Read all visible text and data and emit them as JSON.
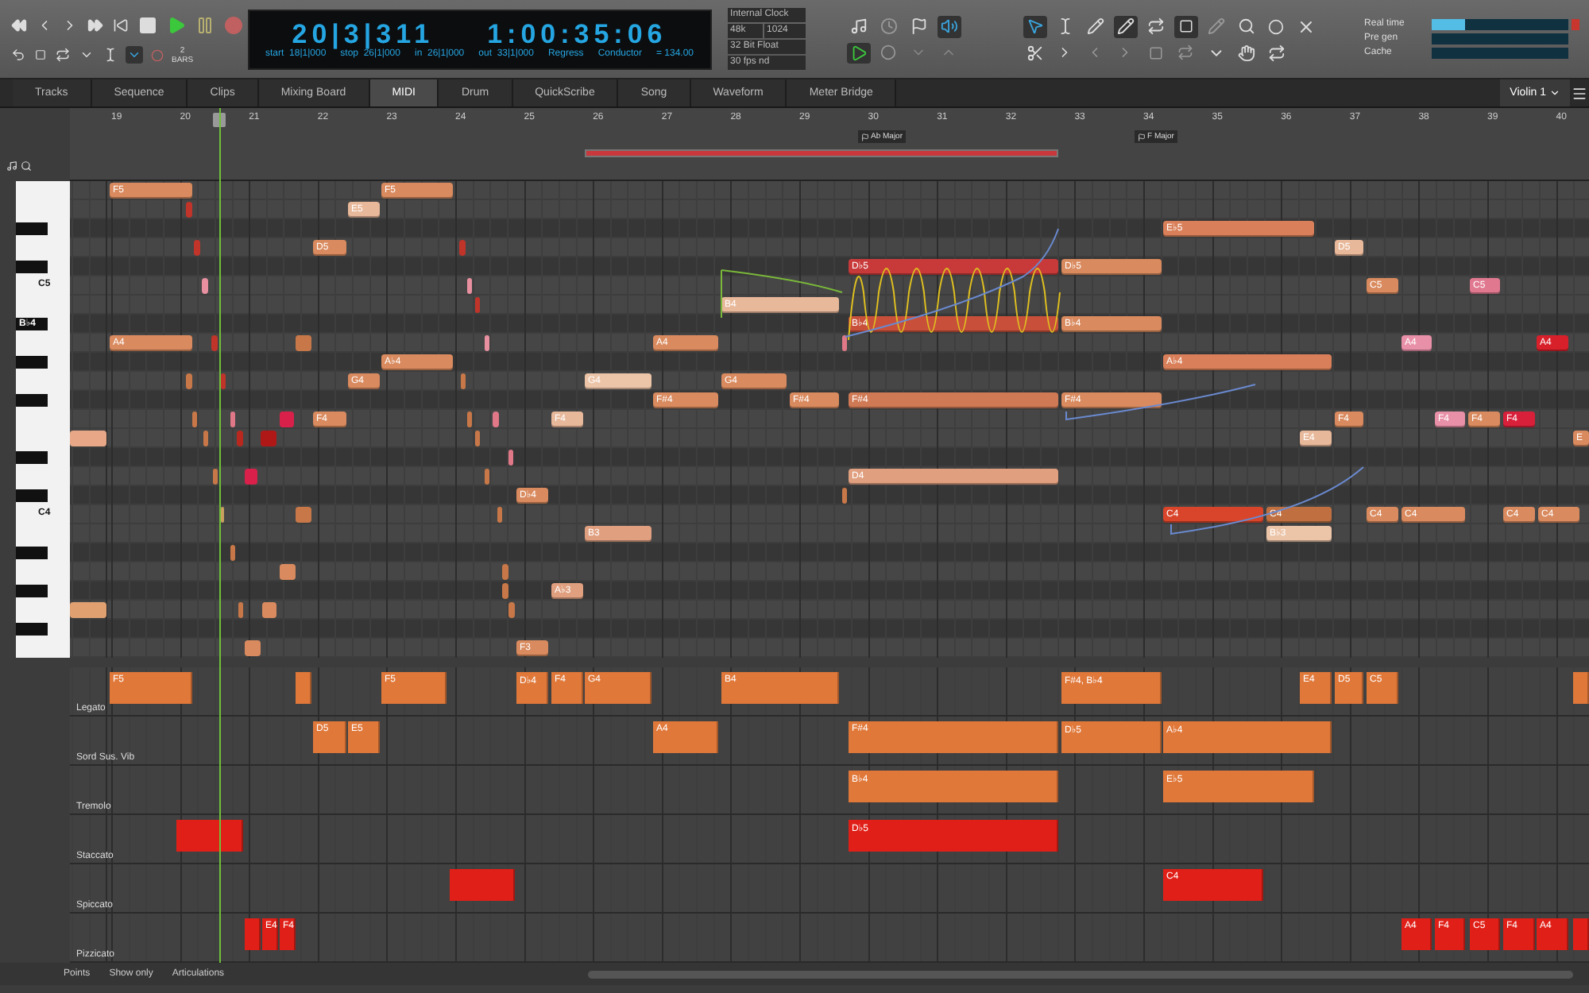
{
  "transport": {
    "position": "20|3|311",
    "time": "1:00:35:06",
    "bars_count": "2",
    "bars_unit": "BARS",
    "fields": [
      {
        "label": "start",
        "value": "18|1|000"
      },
      {
        "label": "stop",
        "value": "26|1|000"
      },
      {
        "label": "in",
        "value": "26|1|000"
      },
      {
        "label": "out",
        "value": "33|1|000"
      }
    ],
    "mode": "Regress",
    "conductor": "Conductor",
    "tempo": "= 134.00"
  },
  "audio": {
    "clock": "Internal Clock",
    "rate": "48k",
    "buffer": "1024",
    "format": "32 Bit Float",
    "frame_rate": "30 fps nd"
  },
  "meters": [
    {
      "label": "Real time",
      "level": 0.25
    },
    {
      "label": "Pre gen"
    },
    {
      "label": "Cache"
    }
  ],
  "tabs": [
    {
      "label": "Tracks",
      "selected": false
    },
    {
      "label": "Sequence",
      "selected": false
    },
    {
      "label": "Clips",
      "selected": false
    },
    {
      "label": "Mixing Board",
      "selected": false
    },
    {
      "label": "MIDI",
      "selected": true
    },
    {
      "label": "Drum",
      "selected": false
    },
    {
      "label": "QuickScribe",
      "selected": false
    },
    {
      "label": "Song",
      "selected": false
    },
    {
      "label": "Waveform",
      "selected": false
    },
    {
      "label": "Meter Bridge",
      "selected": false
    }
  ],
  "track": "Violin 1",
  "ruler": {
    "bars": [
      "19",
      "20",
      "21",
      "22",
      "23",
      "24",
      "25",
      "26",
      "27",
      "28",
      "29",
      "30",
      "31",
      "32",
      "33",
      "34",
      "35",
      "36",
      "37",
      "38",
      "39",
      "40"
    ],
    "keys": [
      {
        "label": "Ab Major"
      },
      {
        "label": "F Major"
      }
    ]
  },
  "keyboard": [
    "C5",
    "B♭4",
    "C4"
  ],
  "notes": [
    {
      "label": "F5",
      "color": "#d98a5e"
    },
    {
      "label": "F5",
      "color": "#d98a5e"
    },
    {
      "label": "E5",
      "color": "#e8b89a"
    },
    {
      "label": "D5",
      "color": "#d98a5e"
    },
    {
      "label": "A4",
      "color": "#d98a5e"
    },
    {
      "label": "A♭4",
      "color": "#d98a5e"
    },
    {
      "label": "G4",
      "color": "#d98a5e"
    },
    {
      "label": "F4",
      "color": "#d98a5e"
    },
    {
      "label": "D♭4",
      "color": "#d98a5e"
    },
    {
      "label": "F4",
      "color": "#e8b89a"
    },
    {
      "label": "A♭3",
      "color": "#e0a080"
    },
    {
      "label": "F3",
      "color": "#d98a5e"
    },
    {
      "label": "G4",
      "color": "#ecc4a8"
    },
    {
      "label": "B3",
      "color": "#e0a080"
    },
    {
      "label": "A4",
      "color": "#d98a5e"
    },
    {
      "label": "F#4",
      "color": "#d98a5e"
    },
    {
      "label": "B4",
      "color": "#e8b89a"
    },
    {
      "label": "G4",
      "color": "#d98a5e"
    },
    {
      "label": "F#4",
      "color": "#d98a5e"
    },
    {
      "label": "D♭5",
      "color": "#c83a3a"
    },
    {
      "label": "D♭5",
      "color": "#d98a5e"
    },
    {
      "label": "B♭4",
      "color": "#c8503a"
    },
    {
      "label": "B♭4",
      "color": "#d98a5e"
    },
    {
      "label": "F#4",
      "color": "#d07a55"
    },
    {
      "label": "F#4",
      "color": "#d98a5e"
    },
    {
      "label": "D4",
      "color": "#e0a080"
    },
    {
      "label": "E♭5",
      "color": "#d9805a"
    },
    {
      "label": "A♭4",
      "color": "#d9805a"
    },
    {
      "label": "C4",
      "color": "#d8452a"
    },
    {
      "label": "C4",
      "color": "#c07040"
    },
    {
      "label": "B♭3",
      "color": "#ecc4a8"
    },
    {
      "label": "E4",
      "color": "#e8b89a"
    },
    {
      "label": "D5",
      "color": "#e8b89a"
    },
    {
      "label": "F4",
      "color": "#d98a5e"
    },
    {
      "label": "C5",
      "color": "#d98a5e"
    },
    {
      "label": "C4",
      "color": "#d98a5e"
    },
    {
      "label": "A4",
      "color": "#e890a8"
    },
    {
      "label": "C4",
      "color": "#d98a5e"
    },
    {
      "label": "F4",
      "color": "#e890a8"
    },
    {
      "label": "C5",
      "color": "#e07890"
    },
    {
      "label": "F4",
      "color": "#d98a5e"
    },
    {
      "label": "F4",
      "color": "#d8203a"
    },
    {
      "label": "C4",
      "color": "#d98a5e"
    },
    {
      "label": "A4",
      "color": "#d8202a"
    },
    {
      "label": "C4",
      "color": "#d98a5e"
    },
    {
      "label": "E",
      "color": "#d98a5e"
    }
  ],
  "lanes": [
    {
      "name": "Legato",
      "blocks": [
        {
          "label": "F5",
          "color": "#e0783a"
        },
        {
          "color": "#e0783a"
        },
        {
          "label": "F5",
          "color": "#e0783a"
        },
        {
          "label": "D♭4",
          "color": "#e0783a"
        },
        {
          "label": "F4",
          "color": "#e0783a"
        },
        {
          "label": "G4",
          "color": "#e0783a"
        },
        {
          "label": "B4",
          "color": "#e0783a"
        },
        {
          "label": "F#4, B♭4",
          "color": "#e0783a"
        },
        {
          "label": "E4",
          "color": "#e0783a"
        },
        {
          "label": "D5",
          "color": "#e0783a"
        },
        {
          "label": "C5",
          "color": "#e0783a"
        },
        {
          "color": "#e0783a"
        }
      ]
    },
    {
      "name": "Sord Sus. Vib",
      "blocks": [
        {
          "label": "D5",
          "color": "#e0783a"
        },
        {
          "label": "E5",
          "color": "#e0783a"
        },
        {
          "label": "A4",
          "color": "#e0783a"
        },
        {
          "label": "F#4",
          "color": "#e0783a"
        },
        {
          "label": "D♭5",
          "color": "#e0783a"
        },
        {
          "label": "A♭4",
          "color": "#e0783a"
        }
      ]
    },
    {
      "name": "Tremolo",
      "blocks": [
        {
          "label": "B♭4",
          "color": "#e0783a"
        },
        {
          "label": "E♭5",
          "color": "#e0783a"
        }
      ]
    },
    {
      "name": "Staccato",
      "blocks": [
        {
          "color": "#e02018"
        },
        {
          "label": "D♭5",
          "color": "#e02018"
        }
      ]
    },
    {
      "name": "Spiccato",
      "blocks": [
        {
          "color": "#e02018"
        },
        {
          "label": "C4",
          "color": "#e02018"
        }
      ]
    },
    {
      "name": "Pizzicato",
      "blocks": [
        {
          "color": "#e02018"
        },
        {
          "label": "E4",
          "color": "#e02018"
        },
        {
          "label": "F4",
          "color": "#e02018"
        },
        {
          "label": "A4",
          "color": "#e02018"
        },
        {
          "label": "F4",
          "color": "#e02018"
        },
        {
          "label": "C5",
          "color": "#e02018"
        },
        {
          "label": "F4",
          "color": "#e02018"
        },
        {
          "label": "A4",
          "color": "#e02018"
        },
        {
          "color": "#e02018"
        }
      ]
    }
  ],
  "bottom": {
    "mode": "Points",
    "filter": "Show only",
    "lane_set": "Articulations"
  }
}
